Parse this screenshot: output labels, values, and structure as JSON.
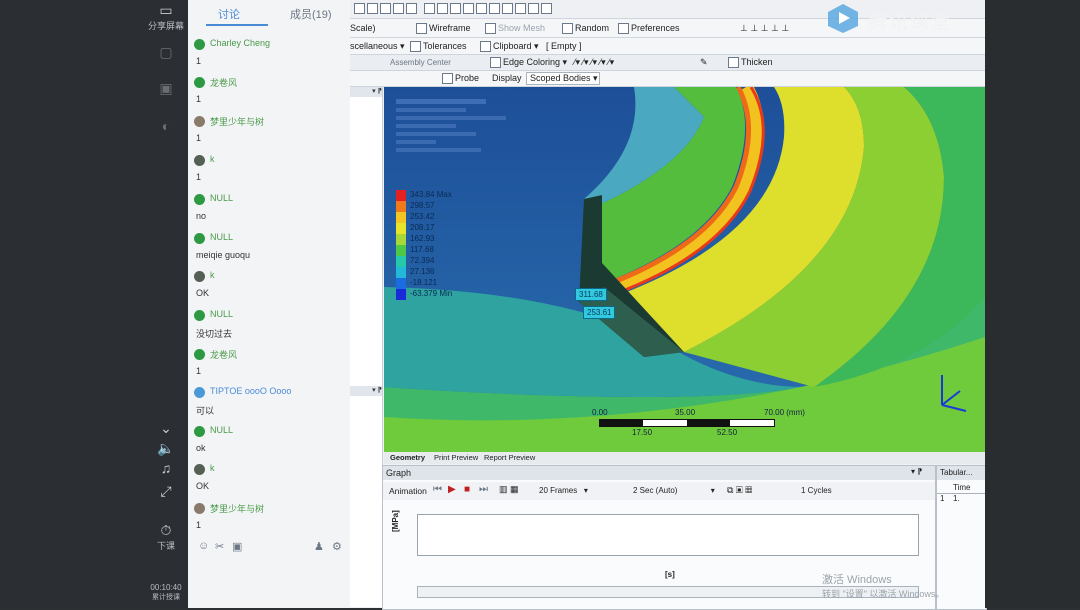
{
  "left_sidebar": {
    "share_screen": "分享屏幕",
    "leave_class": "下课",
    "timer": "00:10:40",
    "timer_label": "累计授课"
  },
  "chat": {
    "tabs": [
      "讨论",
      "成员(19)"
    ],
    "messages": [
      {
        "name": "Charley Cheng",
        "text": "1"
      },
      {
        "name": "龙卷风",
        "text": "1"
      },
      {
        "name": "梦里少年与树",
        "text": "1"
      },
      {
        "name": "k",
        "text": "1"
      },
      {
        "name": "NULL",
        "text": "no"
      },
      {
        "name": "NULL",
        "text": "meiqie guoqu"
      },
      {
        "name": "k",
        "text": "OK"
      },
      {
        "name": "NULL",
        "text": "没切过去"
      },
      {
        "name": "龙卷风",
        "text": "1"
      },
      {
        "name": "TIPTOE oooO Oooo",
        "text": "可以"
      },
      {
        "name": "NULL",
        "text": "ok"
      },
      {
        "name": "k",
        "text": "OK"
      },
      {
        "name": "梦里少年与树",
        "text": "1"
      }
    ]
  },
  "watermark": {
    "brand": "腾讯课堂"
  },
  "toolbar": {
    "scale": "Scale)",
    "wireframe": "Wireframe",
    "show_mesh": "Show Mesh",
    "random": "Random",
    "preferences": "Preferences",
    "miscellaneous": "scellaneous",
    "tolerances": "Tolerances",
    "clipboard": "Clipboard",
    "empty": "[ Empty ]",
    "assembly_center": "Assembly Center",
    "edge_coloring": "Edge Coloring",
    "thicken": "Thicken",
    "probe": "Probe",
    "display": "Display",
    "scoped_bodies": "Scoped Bodies"
  },
  "legend": {
    "entries": [
      {
        "label": "343.84 Max",
        "color": "#e52020"
      },
      {
        "label": "298.57",
        "color": "#f07a1a"
      },
      {
        "label": "253.42",
        "color": "#f4c623"
      },
      {
        "label": "208.17",
        "color": "#e8e42a"
      },
      {
        "label": "162.93",
        "color": "#a8d838"
      },
      {
        "label": "117.68",
        "color": "#4fc84a"
      },
      {
        "label": "72.394",
        "color": "#25c8a8"
      },
      {
        "label": "27.136",
        "color": "#22b8d8"
      },
      {
        "label": "-18.121",
        "color": "#1a6ce0"
      },
      {
        "label": "-63.379 Min",
        "color": "#1a2ad8"
      }
    ]
  },
  "probes": [
    "311.68",
    "253.61"
  ],
  "scale_bar": {
    "top": [
      "0.00",
      "35.00",
      "70.00 (mm)"
    ],
    "bottom": [
      "17.50",
      "52.50"
    ]
  },
  "bottom_tabs": [
    "Geometry",
    "Print Preview",
    "Report Preview"
  ],
  "graph": {
    "title": "Graph",
    "animation": "Animation",
    "frames": "20 Frames",
    "duration": "2 Sec (Auto)",
    "cycles": "1 Cycles",
    "y_label": "[MPa]",
    "x_label": "[s]"
  },
  "tabular": {
    "title": "Tabular...",
    "col_time": "Time",
    "row1_index": "1",
    "row1_value": "1."
  },
  "windows_activation": {
    "line1": "激活 Windows",
    "line2": "转到 \"设置\" 以激活 Windows。"
  }
}
